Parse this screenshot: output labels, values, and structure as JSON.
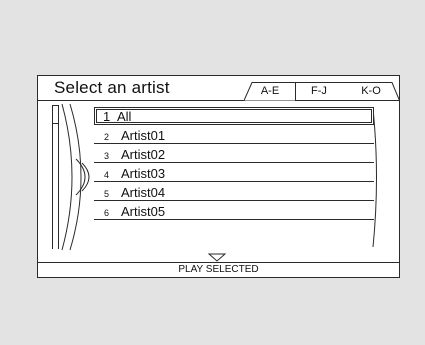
{
  "header": {
    "title": "Select an artist"
  },
  "tabs": [
    {
      "label": "A-E",
      "active": true
    },
    {
      "label": "F-J",
      "active": false
    },
    {
      "label": "K-O",
      "active": false
    }
  ],
  "list": {
    "items": [
      {
        "number": "1",
        "label": "All",
        "selected": true
      },
      {
        "number": "2",
        "label": "Artist01"
      },
      {
        "number": "3",
        "label": "Artist02"
      },
      {
        "number": "4",
        "label": "Artist03"
      },
      {
        "number": "5",
        "label": "Artist04"
      },
      {
        "number": "6",
        "label": "Artist05"
      }
    ]
  },
  "footer": {
    "action_label": "PLAY SELECTED"
  },
  "icons": {
    "scroll": "chevron-down-icon",
    "disc": "disc-icon"
  },
  "colors": {
    "line": "#2a2a2a",
    "background": "#e3e3e3",
    "screen": "#ffffff"
  }
}
